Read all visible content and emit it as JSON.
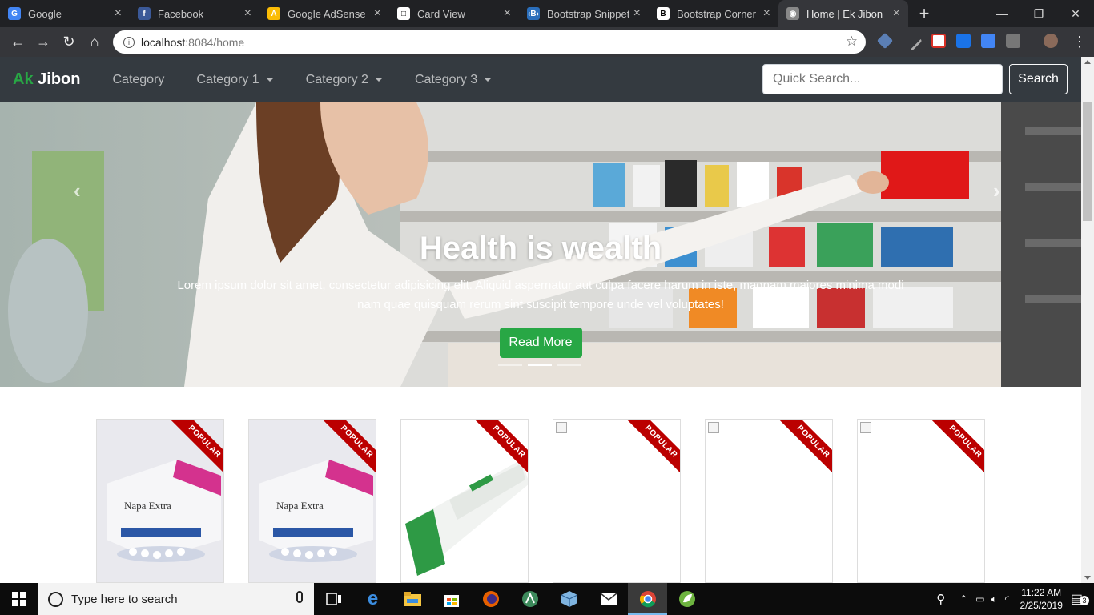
{
  "browser": {
    "tabs": [
      {
        "title": "Google",
        "favicon": "google-icon",
        "color": "#4285f4",
        "glyph": "G"
      },
      {
        "title": "Facebook",
        "favicon": "facebook-icon",
        "color": "#3b5998",
        "glyph": "f"
      },
      {
        "title": "Google AdSense",
        "favicon": "adsense-icon",
        "color": "#fbbc05",
        "glyph": "A"
      },
      {
        "title": "Card View",
        "favicon": "document-icon",
        "color": "#ffffff",
        "glyph": "□"
      },
      {
        "title": "Bootstrap Snippet",
        "favicon": "bootsnipp-icon",
        "color": "#2a6ebb",
        "glyph": "‹B›"
      },
      {
        "title": "Bootstrap Corner",
        "favicon": "bootstrap-icon",
        "color": "#ffffff",
        "glyph": "B"
      },
      {
        "title": "Home | Ek Jibon",
        "favicon": "site-icon",
        "color": "#888888",
        "glyph": "◉"
      }
    ],
    "url_host": "localhost",
    "url_rest": ":8084/home"
  },
  "site": {
    "brand_accent": "Ak",
    "brand_rest": "Jibon",
    "nav": [
      "Category",
      "Category 1",
      "Category 2",
      "Category 3"
    ],
    "search_placeholder": "Quick Search...",
    "search_button": "Search"
  },
  "hero": {
    "title": "Health is wealth",
    "text": "Lorem ipsum dolor sit amet, consectetur adipisicing elit. Aliquid aspernatur aut culpa facere harum in iste, magnam maiores minima modi nam quae quisquam rerum sint suscipit tempore unde vel voluptates!",
    "button": "Read More",
    "active_slide": 1,
    "slide_count": 3
  },
  "products": {
    "ribbon": "POPULAR",
    "items": [
      {
        "image": "napa-extra-box",
        "loaded": true
      },
      {
        "image": "napa-extra-box",
        "loaded": true
      },
      {
        "image": "nebanol-ointment-tube",
        "loaded": true
      },
      {
        "image": "broken-image",
        "loaded": false
      },
      {
        "image": "broken-image",
        "loaded": false
      },
      {
        "image": "broken-image",
        "loaded": false
      }
    ]
  },
  "taskbar": {
    "search_placeholder": "Type here to search",
    "time": "11:22 AM",
    "date": "2/25/2019",
    "notifications": "3"
  },
  "colors": {
    "brand_green": "#28a745",
    "navbar_bg": "#343a40",
    "ribbon_red": "#bb0000"
  }
}
